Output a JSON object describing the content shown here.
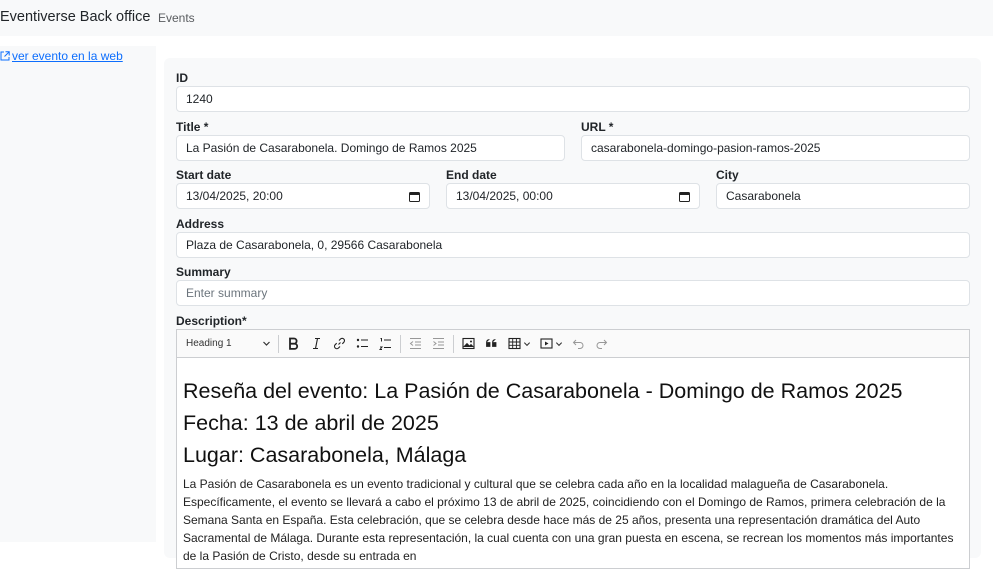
{
  "navbar": {
    "brand": "Eventiverse Back office",
    "events_link": "Events"
  },
  "sidebar": {
    "web_link": "ver evento en la web"
  },
  "form": {
    "id": {
      "label": "ID",
      "value": "1240"
    },
    "title": {
      "label": "Title *",
      "value": "La Pasión de Casarabonela. Domingo de Ramos 2025"
    },
    "url": {
      "label": "URL *",
      "value": "casarabonela-domingo-pasion-ramos-2025"
    },
    "start_date": {
      "label": "Start date",
      "value": "13/04/2025, 20:00"
    },
    "end_date": {
      "label": "End date",
      "value": "13/04/2025, 00:00"
    },
    "city": {
      "label": "City",
      "value": "Casarabonela"
    },
    "address": {
      "label": "Address",
      "value": "Plaza de Casarabonela, 0, 29566 Casarabonela"
    },
    "summary": {
      "label": "Summary",
      "placeholder": "Enter summary"
    },
    "description": {
      "label": "Description*"
    }
  },
  "editor": {
    "heading_select": "Heading 1",
    "toolbar_icons": [
      "bold-icon",
      "italic-icon",
      "link-icon",
      "bulleted-list-icon",
      "numbered-list-icon",
      "outdent-icon",
      "indent-icon",
      "image-icon",
      "blockquote-icon",
      "table-icon",
      "media-icon",
      "undo-icon",
      "redo-icon"
    ],
    "headings": [
      "Reseña del evento: La Pasión de Casarabonela - Domingo de Ramos 2025",
      "Fecha: 13 de abril de 2025",
      "Lugar: Casarabonela, Málaga"
    ],
    "paragraph": "La Pasión de Casarabonela es un evento tradicional y cultural que se celebra cada año en la localidad malagueña de Casarabonela. Específicamente, el evento se llevará a cabo el próximo 13 de abril de 2025, coincidiendo con el Domingo de Ramos, primera celebración de la Semana Santa en España. Esta celebración, que se celebra desde hace más de 25 años, presenta una representación dramática del Auto Sacramental de Málaga. Durante esta representación, la cual cuenta con una gran puesta en escena, se recrean los momentos más importantes de la Pasión de Cristo, desde su entrada en"
  },
  "colors": {
    "link": "#0d6efd",
    "panel": "#f8f9fa",
    "border": "#dee2e6"
  }
}
